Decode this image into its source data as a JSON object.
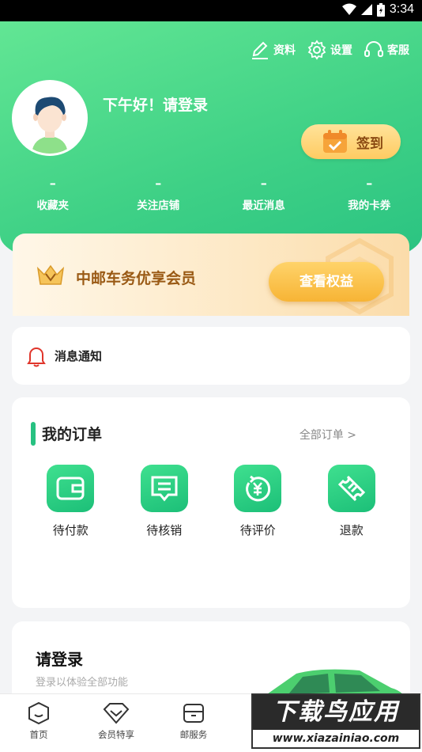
{
  "status_bar": {
    "time": "3:34"
  },
  "header": {
    "actions": [
      {
        "label": "资料",
        "icon": "edit-icon"
      },
      {
        "label": "设置",
        "icon": "gear-icon"
      },
      {
        "label": "客服",
        "icon": "headset-icon"
      }
    ],
    "greeting": "下午好！请登录",
    "signin_label": "签到"
  },
  "stats": [
    {
      "value": "–",
      "label": "收藏夹"
    },
    {
      "value": "–",
      "label": "关注店铺"
    },
    {
      "value": "–",
      "label": "最近消息"
    },
    {
      "value": "–",
      "label": "我的卡券"
    }
  ],
  "vip": {
    "title": "中邮车务优享会员",
    "button": "查看权益"
  },
  "notice": {
    "label": "消息通知"
  },
  "orders": {
    "title": "我的订单",
    "all_link": "全部订单 >",
    "items": [
      {
        "label": "待付款",
        "icon": "wallet-icon"
      },
      {
        "label": "待核销",
        "icon": "message-icon"
      },
      {
        "label": "待评价",
        "icon": "yuan-refresh-icon"
      },
      {
        "label": "退款",
        "icon": "ticket-icon"
      }
    ]
  },
  "login_card": {
    "title": "请登录",
    "subtitle": "登录以体验全部功能"
  },
  "tabbar": [
    {
      "label": "首页",
      "icon": "home-icon"
    },
    {
      "label": "会员特享",
      "icon": "diamond-icon"
    },
    {
      "label": "邮服务",
      "icon": "box-icon"
    }
  ],
  "watermark": {
    "top": "下载鸟应用",
    "bottom": "www.xiazainiao.com"
  },
  "colors": {
    "brand_green": "#27c181",
    "gold": "#f7b435"
  }
}
